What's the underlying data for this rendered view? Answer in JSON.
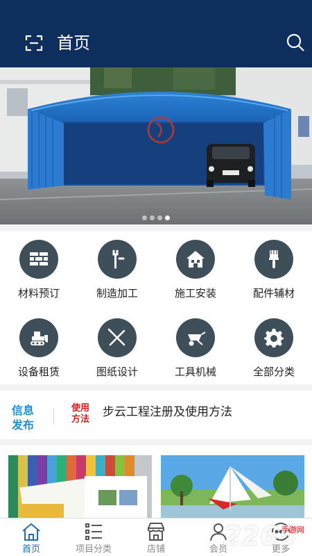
{
  "header": {
    "title": "首页",
    "scan_icon": "scan-icon",
    "search_icon": "search-icon",
    "background": "#0e2f5e"
  },
  "banner": {
    "image": "blue retractable canopy tent with parked car",
    "slide_count": 4,
    "active_slide": 4
  },
  "categories": [
    {
      "label": "材料预订",
      "icon": "brick-wall-icon"
    },
    {
      "label": "制造加工",
      "icon": "wrench-icon"
    },
    {
      "label": "施工安装",
      "icon": "house-icon"
    },
    {
      "label": "配件辅材",
      "icon": "paintbrush-icon"
    },
    {
      "label": "设备租赁",
      "icon": "bulldozer-icon"
    },
    {
      "label": "图纸设计",
      "icon": "drafting-tools-icon"
    },
    {
      "label": "工具机械",
      "icon": "wheelbarrow-icon"
    },
    {
      "label": "全部分类",
      "icon": "gear-icon"
    }
  ],
  "news": {
    "logo_line1": "信息",
    "logo_line2": "发布",
    "tag_line1": "使用",
    "tag_line2": "方法",
    "headline": "步云工程注册及使用方法"
  },
  "products": [
    {
      "image": "colored PVC fabric rolls and brochure"
    },
    {
      "image": "white and red tensile membrane structure in park"
    }
  ],
  "tabbar": [
    {
      "label": "首页",
      "icon": "home-icon",
      "active": true
    },
    {
      "label": "项目分类",
      "icon": "list-icon",
      "active": false
    },
    {
      "label": "店铺",
      "icon": "store-icon",
      "active": false
    },
    {
      "label": "会员",
      "icon": "user-icon",
      "active": false
    },
    {
      "label": "更多",
      "icon": "more-icon",
      "active": false
    }
  ],
  "watermark": {
    "text": "2265",
    "sub": "手游网"
  },
  "colors": {
    "accent": "#1f6fb8",
    "icon_circle": "#3f4f5a",
    "tag_red": "#d7201b",
    "logo_blue": "#1e8ed6"
  }
}
